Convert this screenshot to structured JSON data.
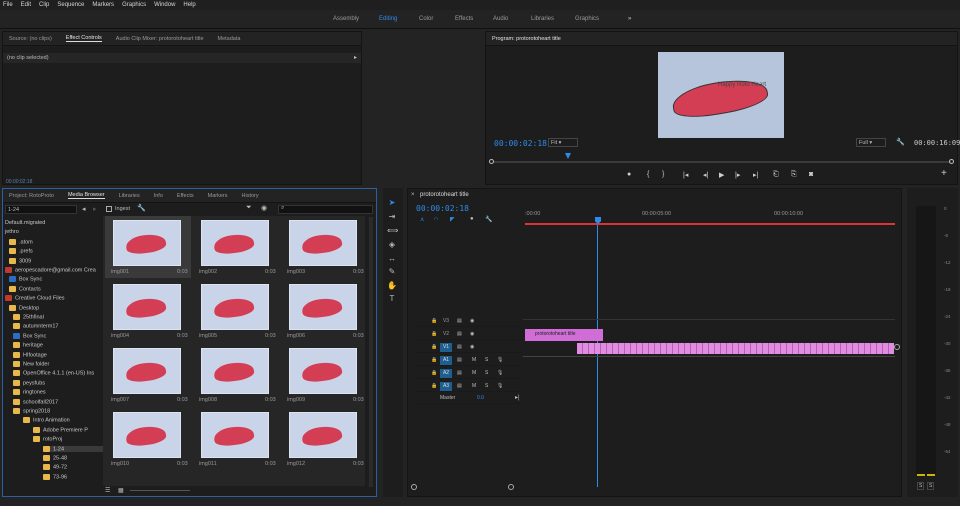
{
  "menu": [
    "File",
    "Edit",
    "Clip",
    "Sequence",
    "Markers",
    "Graphics",
    "Window",
    "Help"
  ],
  "workspaces": [
    "Assembly",
    "Editing",
    "Color",
    "Effects",
    "Audio",
    "Libraries",
    "Graphics"
  ],
  "workspace_overflow": "»",
  "source_panel": {
    "tabs": [
      "Source: (no clips)",
      "Effect Controls",
      "Audio Clip Mixer: protorotoheart title",
      "Metadata"
    ],
    "selected": "Effect Controls",
    "no_clip": "(no clip selected)",
    "timecode": "00:00:02:18"
  },
  "program": {
    "title": "Program: protorotoheart title",
    "timecode": "00:00:02:18",
    "fit": "Fit",
    "quality": "Full",
    "duration": "00:00:16:09",
    "preview_text": "Happy Roto Heart"
  },
  "project_panel": {
    "tabs": [
      "Project: RotoProto",
      "Media Browser",
      "Libraries",
      "Info",
      "Effects",
      "Markers",
      "History"
    ],
    "selected": "Media Browser",
    "filter": "1-24",
    "ingest_label": "Ingest"
  },
  "tree": [
    "Default.migrated",
    "jethro",
    ".atom",
    ".prefs",
    "3009",
    "aeropescadore@gmail.com Crea",
    "Box Sync",
    "Contacts",
    "Creative Cloud Files",
    "Desktop",
    "25thfinal",
    "autumnterm17",
    "Box Sync",
    "heritage",
    "HIfootage",
    "New folder",
    "OpenOffice 4.1.1 (en-US) Ins",
    "peysfubs",
    "ringtones",
    "schoolfall2017",
    "spring2018",
    "Intro Animation",
    "Adobe Premiere P",
    "rotoProj",
    "1-24",
    "25-48",
    "49-72",
    "73-96"
  ],
  "thumbs": [
    {
      "name": "img001",
      "dur": "0:03"
    },
    {
      "name": "img002",
      "dur": "0:03"
    },
    {
      "name": "img003",
      "dur": "0:03"
    },
    {
      "name": "img004",
      "dur": "0:03"
    },
    {
      "name": "img005",
      "dur": "0:03"
    },
    {
      "name": "img006",
      "dur": "0:03"
    },
    {
      "name": "img007",
      "dur": "0:03"
    },
    {
      "name": "img008",
      "dur": "0:03"
    },
    {
      "name": "img009",
      "dur": "0:03"
    },
    {
      "name": "img010",
      "dur": "0:03"
    },
    {
      "name": "img011",
      "dur": "0:03"
    },
    {
      "name": "img012",
      "dur": "0:03"
    }
  ],
  "timeline": {
    "title": "protorotoheart title",
    "timecode": "00:00:02:18",
    "ruler": [
      ":00:00",
      "00:00:05:00",
      "00:00:10:00"
    ],
    "title_clip": "protorotoheart title",
    "tracks": {
      "video": [
        "V3",
        "V2",
        "V1"
      ],
      "audio": [
        "A1",
        "A2",
        "A3"
      ],
      "master": "Master",
      "master_val": "0.0"
    },
    "m_label": "M",
    "s_label": "S"
  },
  "meter": {
    "ticks": [
      "0",
      "-6",
      "-12",
      "-18",
      "-24",
      "-30",
      "-36",
      "-42",
      "-48",
      "-54"
    ],
    "solo": [
      "S",
      "S"
    ]
  },
  "colors": {
    "accent": "#2d8ceb",
    "clip_pink": "#e08ce0",
    "title_clip": "#d06dd6",
    "playhead": "#2d8ceb",
    "red_bar": "#d33"
  }
}
